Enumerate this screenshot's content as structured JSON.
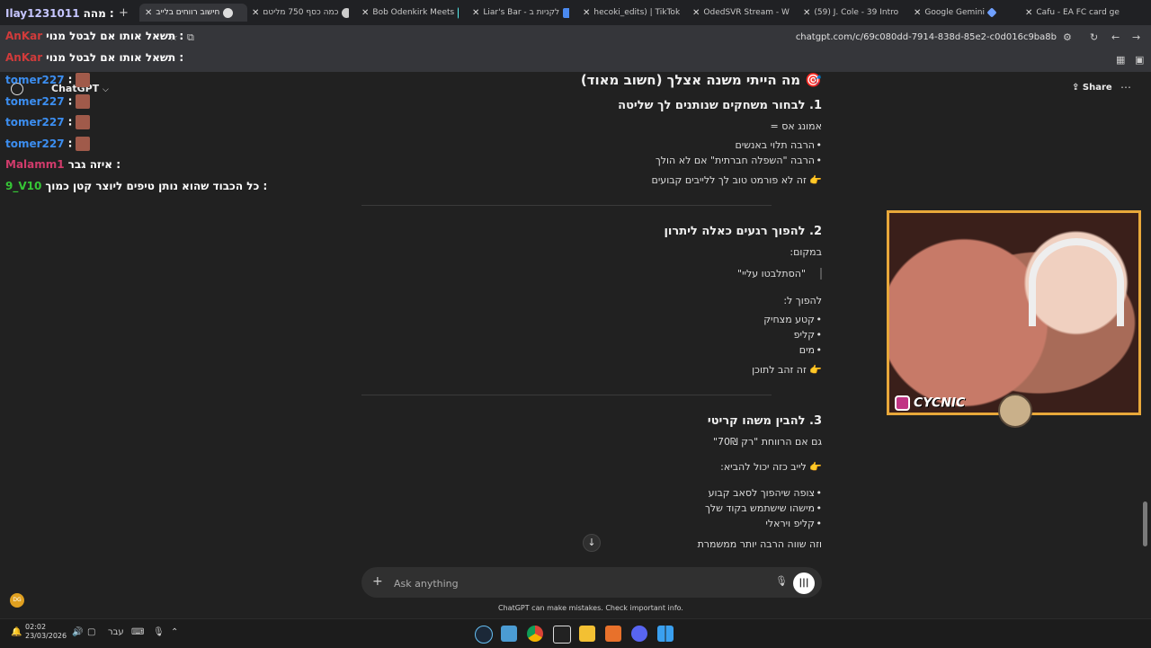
{
  "browser": {
    "tabs": [
      {
        "label": "חישוב רווחים בלייב",
        "active": true
      },
      {
        "label": "כמה כסף 750 מליטם",
        "active": false
      },
      {
        "label": "Bob Odenkirk Meets",
        "active": false
      },
      {
        "label": "Liar's Bar - לקניות ב",
        "active": false
      },
      {
        "label": "hecoki_edits) | TikTok",
        "active": false
      },
      {
        "label": "OdedSVR Stream - W",
        "active": false
      },
      {
        "label": "(59) J. Cole - 39 Intro",
        "active": false
      },
      {
        "label": "Google Gemini",
        "active": false
      },
      {
        "label": "Cafu - EA FC card ge",
        "active": false
      }
    ],
    "new_tab": "+",
    "url": "chatgpt.com/c/69c080dd-7914-838d-85e2-c0d016c9ba8b"
  },
  "chatgpt": {
    "title": "ChatGPT",
    "share": "Share",
    "sections": [
      {
        "heading": "🎯 מה הייתי משנה אצלך (חשוב מאוד)",
        "sub": "1. לבחור משחקים שנותנים לך שליטה",
        "intro": "אמונג אס =",
        "bullets": [
          "הרבה תלוי באנשים",
          "הרבה \"השפלה חברתית\" אם לא הולך"
        ],
        "note": "👉 זה לא פורמט טוב לך ללייבים קבועים"
      },
      {
        "heading": "2. להפוך רגעים כאלה ליתרון",
        "intro": "במקום:",
        "quote": "\"הסתלבטו עליי\"",
        "intro2": "להפוך ל:",
        "bullets": [
          "קטע מצחיק",
          "קליפ",
          "מים"
        ],
        "note": "👉 זה זהב לתוכן"
      },
      {
        "heading": "3. להבין משהו קריטי",
        "intro": "גם אם הרווחת \"רק 70₪\"",
        "intro2": "👉 לייב כזה יכול להביא:",
        "bullets": [
          "צופה שיהפוך לסאב קבוע",
          "מישהו שישתמש בקוד שלך",
          "קליפ ויראלי"
        ],
        "note": "וזה שווה הרבה יותר ממשמרת"
      }
    ],
    "composer_placeholder": "Ask anything",
    "disclaimer": "ChatGPT can make mistakes. Check important info."
  },
  "stream_chat": [
    {
      "user": "Ilay1231011",
      "text": "מהה :",
      "color": "#c6c6ff",
      "emote": false
    },
    {
      "user": "AnKar",
      "text": "תשאל אותו אם לבטל מנוי :",
      "color": "#d13b3b",
      "emote": false
    },
    {
      "user": "AnKar",
      "text": "תשאל אותו אם לבטל מנוי :",
      "color": "#d13b3b",
      "emote": false
    },
    {
      "user": "tomer227",
      "text": ":",
      "color": "#3c8ef0",
      "emote": true
    },
    {
      "user": "tomer227",
      "text": ":",
      "color": "#3c8ef0",
      "emote": true
    },
    {
      "user": "tomer227",
      "text": ":",
      "color": "#3c8ef0",
      "emote": true
    },
    {
      "user": "tomer227",
      "text": ":",
      "color": "#3c8ef0",
      "emote": true
    },
    {
      "user": "Malamm1",
      "text": "איזה גבר :",
      "color": "#d13b6b",
      "emote": false
    },
    {
      "user": "9_V10",
      "text": "כל הכבוד שהוא נותן טיפים ליוצר קטן כמוך :",
      "color": "#36c636",
      "emote": false
    }
  ],
  "webcam": {
    "handle": "CYCNIC"
  },
  "taskbar": {
    "time": "02:02",
    "date": "23/03/2026",
    "lang": "עבר"
  },
  "colors": {
    "accent_border": "#e8a83a",
    "bg": "#212121"
  }
}
